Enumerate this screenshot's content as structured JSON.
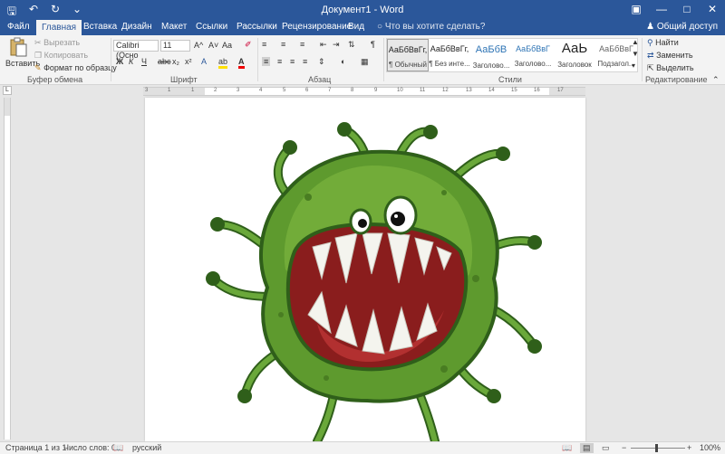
{
  "window": {
    "title": "Документ1 - Word"
  },
  "tabs": [
    {
      "label": "Файл"
    },
    {
      "label": "Главная"
    },
    {
      "label": "Вставка"
    },
    {
      "label": "Дизайн"
    },
    {
      "label": "Макет"
    },
    {
      "label": "Ссылки"
    },
    {
      "label": "Рассылки"
    },
    {
      "label": "Рецензирование"
    },
    {
      "label": "Вид"
    }
  ],
  "tell_me": "Что вы хотите сделать?",
  "share_label": "Общий доступ",
  "clipboard": {
    "paste": "Вставить",
    "cut": "Вырезать",
    "copy": "Копировать",
    "format_painter": "Формат по образцу",
    "group": "Буфер обмена"
  },
  "font": {
    "name": "Calibri (Осно",
    "size": "11",
    "bold": "Ж",
    "italic": "К",
    "underline": "Ч",
    "strike": "abc",
    "subscript": "x₂",
    "superscript": "x²",
    "grow": "A^",
    "shrink": "A˅",
    "case": "Aa",
    "group": "Шрифт"
  },
  "paragraph": {
    "group": "Абзац"
  },
  "styles": {
    "items": [
      {
        "sample": "АаБбВвГг,",
        "name": "¶ Обычный"
      },
      {
        "sample": "АаБбВвГг,",
        "name": "¶ Без инте..."
      },
      {
        "sample": "АаБбВ",
        "name": "Заголово..."
      },
      {
        "sample": "АаБбВвГ",
        "name": "Заголово..."
      },
      {
        "sample": "АаЬ",
        "name": "Заголовок"
      },
      {
        "sample": "АаБбВвГ",
        "name": "Подзагол..."
      }
    ],
    "group": "Стили"
  },
  "editing": {
    "find": "Найти",
    "replace": "Заменить",
    "select": "Выделить",
    "group": "Редактирование"
  },
  "ruler": {
    "ticks": [
      "3",
      "1",
      "1",
      "2",
      "3",
      "4",
      "5",
      "6",
      "7",
      "8",
      "9",
      "10",
      "11",
      "12",
      "13",
      "14",
      "15",
      "16",
      "17"
    ]
  },
  "status": {
    "page": "Страница 1 из 1",
    "words": "Число слов: 0",
    "language": "русский",
    "zoom": "100%"
  },
  "colors": {
    "accent": "#2b579a",
    "virus_body": "#5e9a2e",
    "virus_dark": "#2f5f1a"
  }
}
